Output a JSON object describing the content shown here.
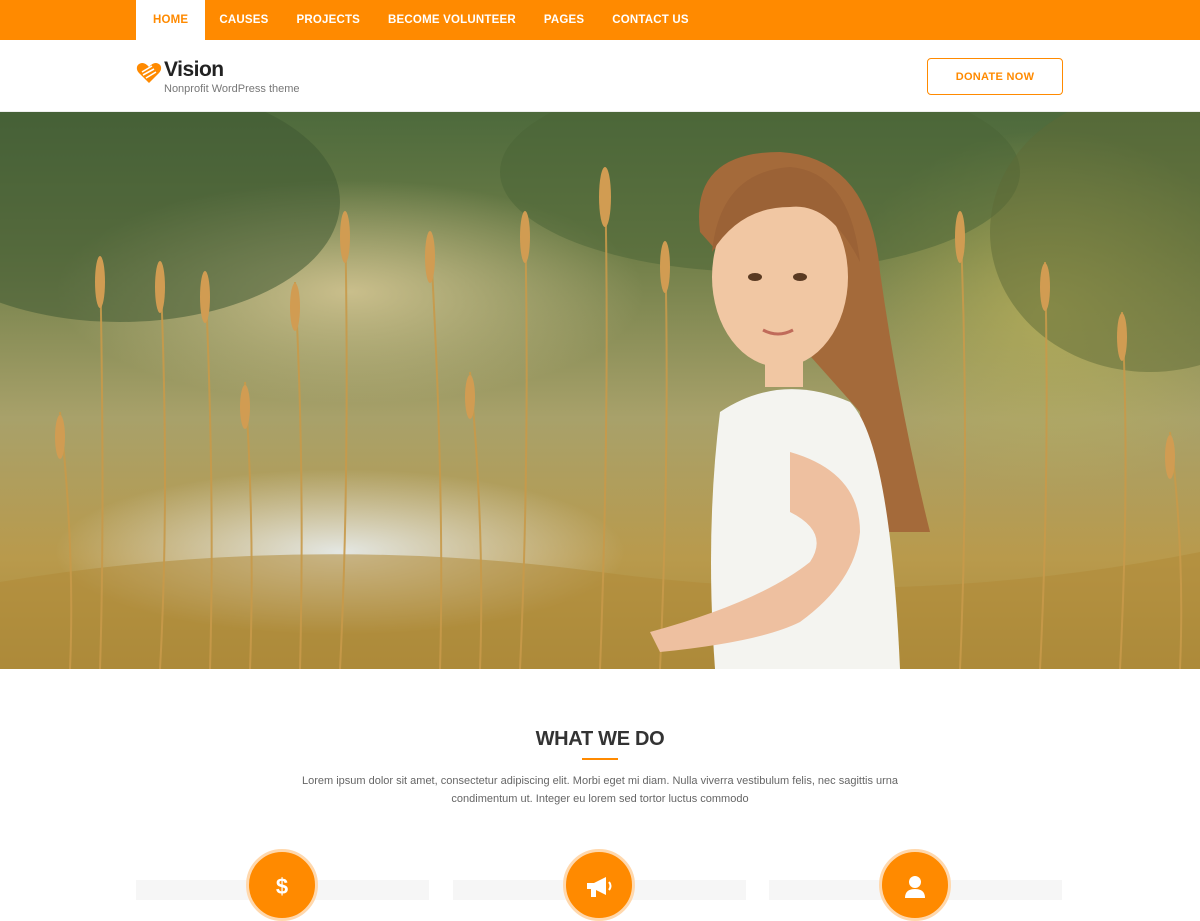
{
  "nav": {
    "items": [
      {
        "label": "HOME",
        "active": true
      },
      {
        "label": "CAUSES",
        "active": false
      },
      {
        "label": "PROJECTS",
        "active": false
      },
      {
        "label": "BECOME VOLUNTEER",
        "active": false
      },
      {
        "label": "PAGES",
        "active": false
      },
      {
        "label": "CONTACT US",
        "active": false
      }
    ]
  },
  "brand": {
    "name": "Vision",
    "tagline": "Nonprofit WordPress theme",
    "icon": "heart-icon"
  },
  "header": {
    "donate_label": "DONATE NOW"
  },
  "hero": {
    "image": "girl-in-wheat-field-photo"
  },
  "what_we_do": {
    "title": "WHAT WE DO",
    "description": "Lorem ipsum dolor sit amet, consectetur adipiscing elit. Morbi eget mi diam. Nulla viverra vestibulum felis, nec sagittis urna condimentum ut. Integer eu lorem sed tortor luctus commodo",
    "cards": [
      {
        "icon": "dollar-icon",
        "glyph": "$"
      },
      {
        "icon": "megaphone-icon",
        "glyph": ""
      },
      {
        "icon": "user-icon",
        "glyph": ""
      }
    ]
  },
  "colors": {
    "accent": "#ff8a00",
    "accent_light": "#ffd8ad",
    "text_dark": "#333333",
    "text_muted": "#666666"
  }
}
